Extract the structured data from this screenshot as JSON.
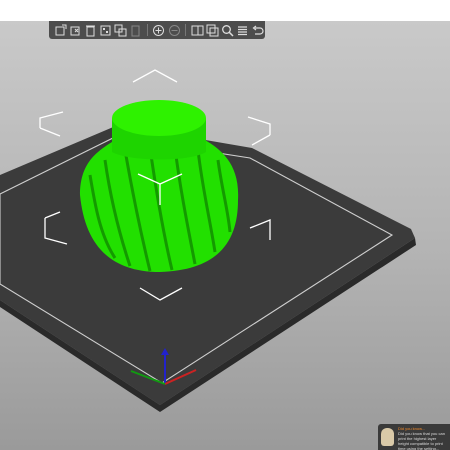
{
  "app": {
    "accent": "#f08a2c",
    "model_color": "#1fe000",
    "bed_color": "#3d3d3d"
  },
  "toolbar": {
    "buttons": [
      {
        "name": "add-icon"
      },
      {
        "name": "delete-icon"
      },
      {
        "name": "delete-all-icon"
      },
      {
        "name": "arrange-icon"
      },
      {
        "name": "copy-icon"
      },
      {
        "name": "paste-icon"
      },
      {
        "name": "add-instance-icon"
      },
      {
        "name": "remove-instance-icon"
      },
      {
        "name": "split-objects-icon"
      },
      {
        "name": "split-parts-icon"
      },
      {
        "name": "search-icon"
      },
      {
        "name": "layers-icon"
      },
      {
        "name": "undo-icon"
      }
    ]
  },
  "notification": {
    "title": "Did you know...",
    "text": "Did you know that you can print the highest layer height compatible to print time using the setting..."
  }
}
